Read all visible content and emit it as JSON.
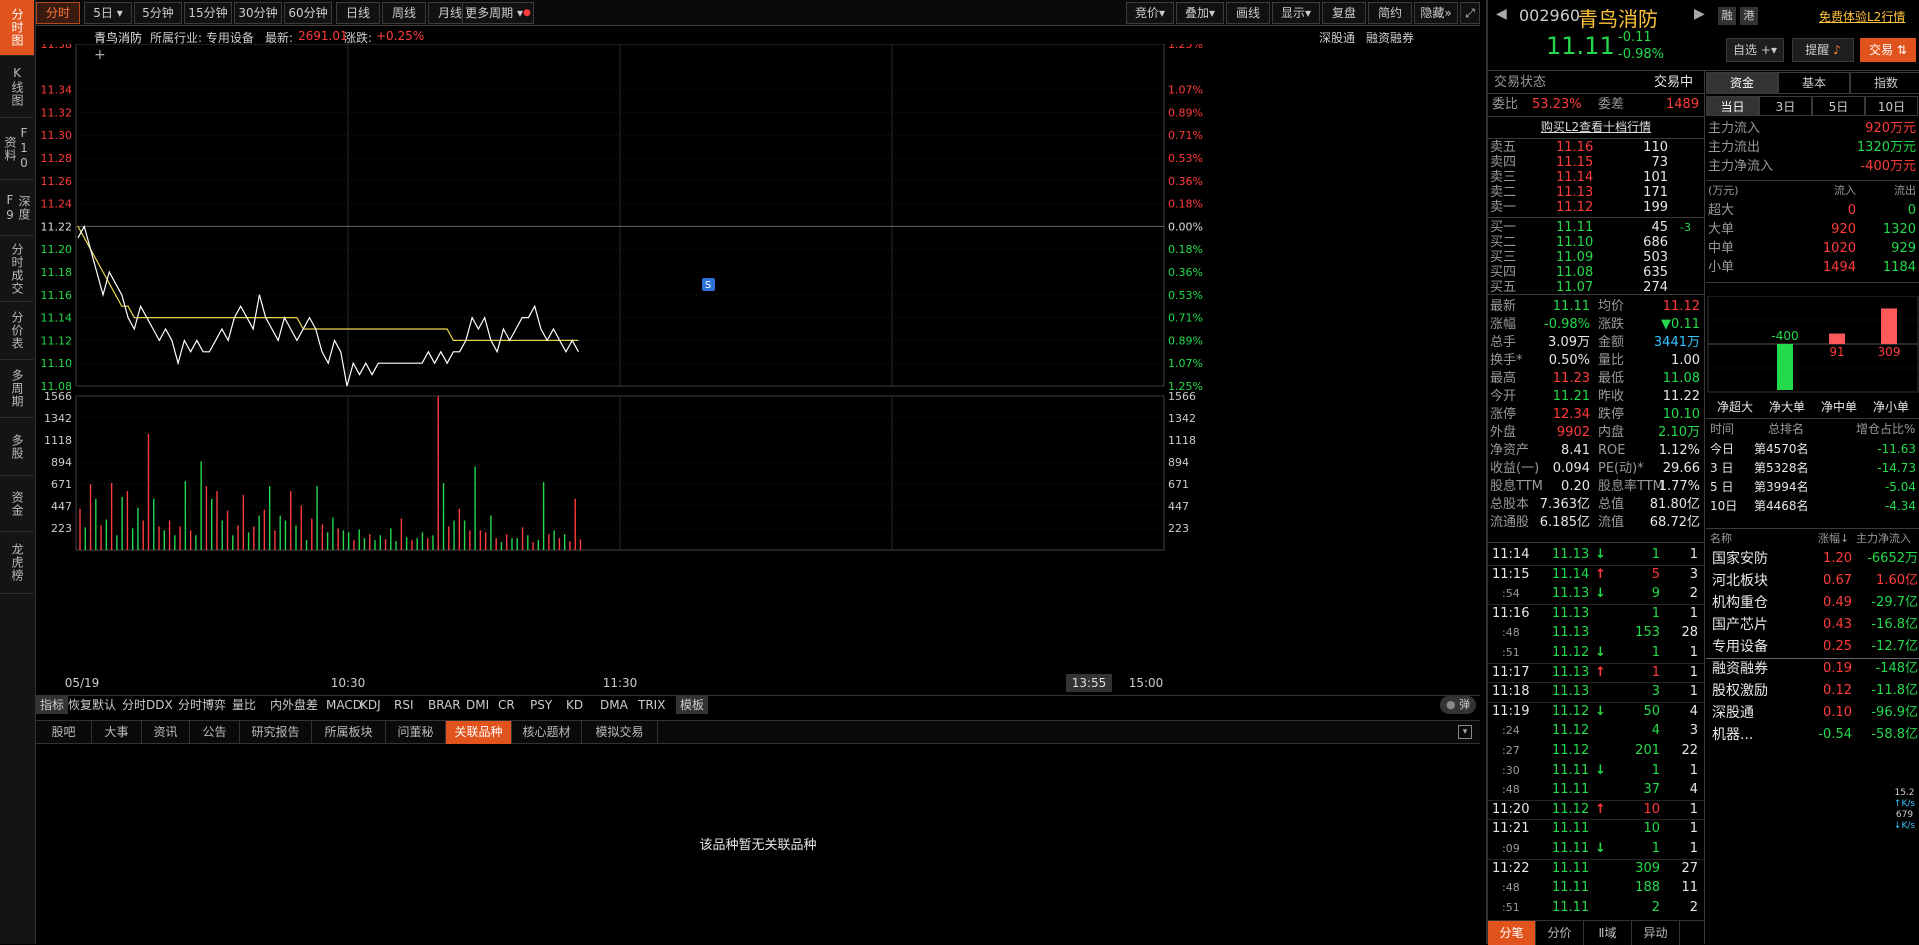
{
  "left_tabs": [
    "分时图",
    "K线图",
    "F10资料",
    "深度F9",
    "分时成交",
    "分价表",
    "多周期",
    "多股",
    "资金",
    "龙虎榜"
  ],
  "toolbar": {
    "periods": [
      "分时",
      "5日",
      "5分钟",
      "15分钟",
      "30分钟",
      "60分钟",
      "日线",
      "周线",
      "月线",
      "更多周期"
    ],
    "right_buttons": [
      "竞价",
      "叠加",
      "画线",
      "显示",
      "复盘",
      "简约",
      "隐藏"
    ]
  },
  "chart_header": {
    "name": "青鸟消防",
    "industry": "所属行业: 专用设备",
    "latest_label": "最新:",
    "latest_value": "2691.01",
    "change_label": "涨跌:",
    "change_value": "+0.25%",
    "right_links": [
      "深股通",
      "融资融券"
    ]
  },
  "chart_data": [
    {
      "type": "line",
      "title": "",
      "x_tick_labels": [
        "05/19",
        "10:30",
        "11:30",
        "13:55",
        "15:00"
      ],
      "y_ticks": [
        "11.38",
        "11.34",
        "11.32",
        "11.30",
        "11.28",
        "11.26",
        "11.24",
        "11.22",
        "11.20",
        "11.18",
        "11.16",
        "11.14",
        "11.12",
        "11.10",
        "11.08"
      ],
      "y_pct_ticks": [
        "1.25%",
        "1.07%",
        "0.89%",
        "0.71%",
        "0.53%",
        "0.36%",
        "0.18%",
        "0.00%",
        "0.18%",
        "0.36%",
        "0.53%",
        "0.71%",
        "0.89%",
        "1.07%",
        "1.25%"
      ],
      "ylim": [
        11.08,
        11.38
      ],
      "prev_close": 11.22,
      "series": [
        {
          "values": [
            11.21,
            11.22,
            11.2,
            11.18,
            11.16,
            11.18,
            11.17,
            11.16,
            11.14,
            11.13,
            11.15,
            11.14,
            11.13,
            11.12,
            11.13,
            11.12,
            11.1,
            11.12,
            11.11,
            11.12,
            11.11,
            11.11,
            11.12,
            11.13,
            11.12,
            11.14,
            11.15,
            11.14,
            11.13,
            11.16,
            11.14,
            11.13,
            11.12,
            11.14,
            11.13,
            11.12,
            11.13,
            11.14,
            11.13,
            11.11,
            11.1,
            11.12,
            11.11,
            11.08,
            11.1,
            11.09,
            11.1,
            11.09,
            11.1,
            11.1,
            11.1,
            11.1,
            11.1,
            11.1,
            11.1,
            11.1,
            11.11,
            11.1,
            11.11,
            11.1,
            11.11,
            11.11,
            11.12,
            11.14,
            11.13,
            11.14,
            11.12,
            11.11,
            11.13,
            11.12,
            11.13,
            11.14,
            11.14,
            11.15,
            11.13,
            11.12,
            11.13,
            11.12,
            11.11,
            11.12,
            11.11
          ]
        },
        {
          "values": [
            11.22,
            11.21,
            11.2,
            11.19,
            11.18,
            11.17,
            11.16,
            11.15,
            11.15,
            11.14,
            11.14,
            11.14,
            11.14,
            11.14,
            11.14,
            11.14,
            11.14,
            11.14,
            11.14,
            11.14,
            11.14,
            11.14,
            11.14,
            11.14,
            11.14,
            11.14,
            11.14,
            11.14,
            11.14,
            11.14,
            11.14,
            11.14,
            11.14,
            11.14,
            11.14,
            11.14,
            11.13,
            11.13,
            11.13,
            11.13,
            11.13,
            11.13,
            11.13,
            11.13,
            11.13,
            11.13,
            11.13,
            11.13,
            11.13,
            11.13,
            11.13,
            11.13,
            11.13,
            11.13,
            11.13,
            11.13,
            11.13,
            11.13,
            11.13,
            11.13,
            11.12,
            11.12,
            11.12,
            11.12,
            11.12,
            11.12,
            11.12,
            11.12,
            11.12,
            11.12,
            11.12,
            11.12,
            11.12,
            11.12,
            11.12,
            11.12,
            11.12,
            11.12,
            11.12,
            11.12,
            11.12
          ]
        }
      ]
    },
    {
      "type": "bar",
      "title": "",
      "y_ticks": [
        "1566",
        "1342",
        "1118",
        "894",
        "671",
        "447",
        "223"
      ],
      "ylim": [
        0,
        1566
      ],
      "values": [
        420,
        230,
        670,
        520,
        250,
        310,
        680,
        150,
        540,
        600,
        220,
        430,
        300,
        1180,
        520,
        240,
        200,
        300,
        150,
        240,
        700,
        200,
        150,
        900,
        650,
        520,
        600,
        300,
        400,
        150,
        250,
        560,
        180,
        240,
        350,
        410,
        650,
        200,
        350,
        300,
        600,
        250,
        450,
        100,
        320,
        650,
        260,
        180,
        330,
        220,
        200,
        180,
        100,
        210,
        120,
        160,
        100,
        150,
        110,
        220,
        90,
        320,
        130,
        100,
        120,
        180,
        120,
        150,
        1566,
        680,
        240,
        300,
        420,
        300,
        200,
        850,
        200,
        180,
        350,
        120,
        80,
        160,
        120,
        120,
        230,
        150,
        80,
        100,
        690,
        160,
        200,
        120,
        160,
        90,
        520,
        110
      ],
      "colors": [
        "r",
        "g",
        "r",
        "g",
        "r",
        "g",
        "r",
        "g",
        "g",
        "r",
        "g",
        "g",
        "r",
        "r",
        "g",
        "r",
        "g",
        "r",
        "g",
        "r",
        "g",
        "r",
        "g",
        "g",
        "r",
        "g",
        "r",
        "g",
        "r",
        "g",
        "r",
        "r",
        "g",
        "r",
        "g",
        "r",
        "g",
        "r",
        "g",
        "g",
        "r",
        "g",
        "r",
        "g",
        "r",
        "g",
        "r",
        "g",
        "g",
        "r",
        "g",
        "g",
        "r",
        "g",
        "g",
        "r",
        "g",
        "g",
        "r",
        "g",
        "g",
        "r",
        "g",
        "r",
        "g",
        "g",
        "r",
        "g",
        "r",
        "g",
        "r",
        "g",
        "r",
        "g",
        "r",
        "g",
        "r",
        "r",
        "g",
        "r",
        "g",
        "r",
        "g",
        "g",
        "r",
        "g",
        "r",
        "g",
        "g",
        "r",
        "g",
        "r",
        "g",
        "r",
        "r",
        "r"
      ]
    }
  ],
  "chart_labels": {
    "s_badge": "S",
    "time_box": "13:55"
  },
  "indicators": [
    "指标",
    "恢复默认",
    "分时DDX",
    "分时博弈",
    "量比",
    "内外盘差",
    "MACD",
    "KDJ",
    "RSI",
    "BRAR",
    "DMI",
    "CR",
    "PSY",
    "KD",
    "DMA",
    "TRIX",
    "模板"
  ],
  "indicator_right": "弹",
  "news_tabs": [
    "股吧",
    "大事",
    "资讯",
    "公告",
    "研究报告",
    "所属板块",
    "问董秘",
    "关联品种",
    "核心题材",
    "模拟交易"
  ],
  "empty_message": "该品种暂无关联品种",
  "stock": {
    "code": "002960",
    "name": "青鸟消防",
    "badges": [
      "融",
      "港"
    ],
    "promo": "免费体验L2行情",
    "price": "11.11",
    "change": "-0.11",
    "change_pct": "-0.98%",
    "btn_watch": "自选",
    "btn_alert": "提醒",
    "btn_trade": "交易"
  },
  "order_book": {
    "status_label": "交易状态",
    "status_value": "交易中",
    "ratio_label": "委比",
    "ratio_value": "53.23%",
    "diff_label": "委差",
    "diff_value": "1489",
    "l2_link": "购买L2查看十档行情",
    "asks": [
      [
        "卖五",
        "11.16",
        "110"
      ],
      [
        "卖四",
        "11.15",
        "73"
      ],
      [
        "卖三",
        "11.14",
        "101"
      ],
      [
        "卖二",
        "11.13",
        "171"
      ],
      [
        "卖一",
        "11.12",
        "199"
      ]
    ],
    "bids": [
      [
        "买一",
        "11.11",
        "45",
        "-3"
      ],
      [
        "买二",
        "11.10",
        "686",
        ""
      ],
      [
        "买三",
        "11.09",
        "503",
        ""
      ],
      [
        "买四",
        "11.08",
        "635",
        ""
      ],
      [
        "买五",
        "11.07",
        "274",
        ""
      ]
    ]
  },
  "quote": [
    [
      "最新",
      "11.11",
      "均价",
      "11.12"
    ],
    [
      "涨幅",
      "-0.98%",
      "涨跌",
      "▼0.11"
    ],
    [
      "总手",
      "3.09万",
      "金额",
      "3441万"
    ],
    [
      "换手*",
      "0.50%",
      "量比",
      "1.00"
    ],
    [
      "最高",
      "11.23",
      "最低",
      "11.08"
    ],
    [
      "今开",
      "11.21",
      "昨收",
      "11.22"
    ],
    [
      "涨停",
      "12.34",
      "跌停",
      "10.10"
    ],
    [
      "外盘",
      "9902",
      "内盘",
      "2.10万"
    ],
    [
      "净资产",
      "8.41",
      "ROE",
      "1.12%"
    ],
    [
      "收益(一)",
      "0.094",
      "PE(动)*",
      "29.66"
    ],
    [
      "股息TTM",
      "0.20",
      "股息率TTM",
      "1.77%"
    ],
    [
      "总股本",
      "7.363亿",
      "总值",
      "81.80亿"
    ],
    [
      "流通股",
      "6.185亿",
      "流值",
      "68.72亿"
    ]
  ],
  "ticks": [
    [
      "11:14",
      "11.13",
      "↓",
      "1",
      "1"
    ],
    [
      "11:15",
      "11.14",
      "↑",
      "5",
      "3"
    ],
    [
      ":54",
      "11.13",
      "↓",
      "9",
      "2"
    ],
    [
      "11:16",
      "11.13",
      "",
      "1",
      "1"
    ],
    [
      ":48",
      "11.13",
      "",
      "153",
      "28"
    ],
    [
      ":51",
      "11.12",
      "↓",
      "1",
      "1"
    ],
    [
      "11:17",
      "11.13",
      "↑",
      "1",
      "1"
    ],
    [
      "11:18",
      "11.13",
      "",
      "3",
      "1"
    ],
    [
      "11:19",
      "11.12",
      "↓",
      "50",
      "4"
    ],
    [
      ":24",
      "11.12",
      "",
      "4",
      "3"
    ],
    [
      ":27",
      "11.12",
      "",
      "201",
      "22"
    ],
    [
      ":30",
      "11.11",
      "↓",
      "1",
      "1"
    ],
    [
      ":48",
      "11.11",
      "",
      "37",
      "4"
    ],
    [
      "11:20",
      "11.12",
      "↑",
      "10",
      "1"
    ],
    [
      "11:21",
      "11.11",
      "",
      "10",
      "1"
    ],
    [
      ":09",
      "11.11",
      "↓",
      "1",
      "1"
    ],
    [
      "11:22",
      "11.11",
      "",
      "309",
      "27"
    ],
    [
      ":48",
      "11.11",
      "",
      "188",
      "11"
    ],
    [
      ":51",
      "11.11",
      "",
      "2",
      "2"
    ]
  ],
  "bottom_tabs": [
    "分笔",
    "分价",
    "Ⅱ域",
    "异动"
  ],
  "fund": {
    "tabs": [
      "资金",
      "基本",
      "指数"
    ],
    "periods": [
      "当日",
      "3日",
      "5日",
      "10日"
    ],
    "flows": [
      [
        "主力流入",
        "920万元"
      ],
      [
        "主力流出",
        "1320万元"
      ],
      [
        "主力净流入",
        "-400万元"
      ]
    ],
    "table_head": [
      "(万元)",
      "流入",
      "流出"
    ],
    "table": [
      [
        "超大",
        "0",
        "0"
      ],
      [
        "大单",
        "920",
        "1320"
      ],
      [
        "中单",
        "1020",
        "929"
      ],
      [
        "小单",
        "1494",
        "1184"
      ]
    ],
    "net_bars": [
      {
        "label": "净超大",
        "value": 0
      },
      {
        "label": "净大单",
        "value": -400
      },
      {
        "label": "净中单",
        "value": 91
      },
      {
        "label": "净小单",
        "value": 309
      }
    ],
    "rank_head": [
      "时间",
      "总排名",
      "增仓占比%"
    ],
    "rank": [
      [
        "今日",
        "第4570名",
        "-11.63"
      ],
      [
        "3 日",
        "第5328名",
        "-14.73"
      ],
      [
        "5 日",
        "第3994名",
        "-5.04"
      ],
      [
        "10日",
        "第4468名",
        "-4.34"
      ]
    ],
    "sector_head": [
      "名称",
      "涨幅",
      "主力净流入"
    ],
    "sectors": [
      [
        "国家安防",
        "1.20",
        "-6652万"
      ],
      [
        "河北板块",
        "0.67",
        "1.60亿"
      ],
      [
        "机构重仓",
        "0.49",
        "-29.7亿"
      ],
      [
        "国产芯片",
        "0.43",
        "-16.8亿"
      ],
      [
        "专用设备",
        "0.25",
        "-12.7亿"
      ],
      [
        "融资融券",
        "0.19",
        "-148亿"
      ],
      [
        "股权激励",
        "0.12",
        "-11.8亿"
      ],
      [
        "深股通",
        "0.10",
        "-96.9亿"
      ],
      [
        "机器...",
        "-0.54",
        "-58.8亿"
      ]
    ]
  },
  "net_speed": {
    "up": "15.2",
    "up_unit": "K/s",
    "down": "679",
    "down_unit": "K/s"
  },
  "colors": {
    "up": "#ff3b3b",
    "down": "#25d94c",
    "avg_line": "#e8d44d",
    "price_line": "#ffffff",
    "accent": "#e0531d"
  }
}
